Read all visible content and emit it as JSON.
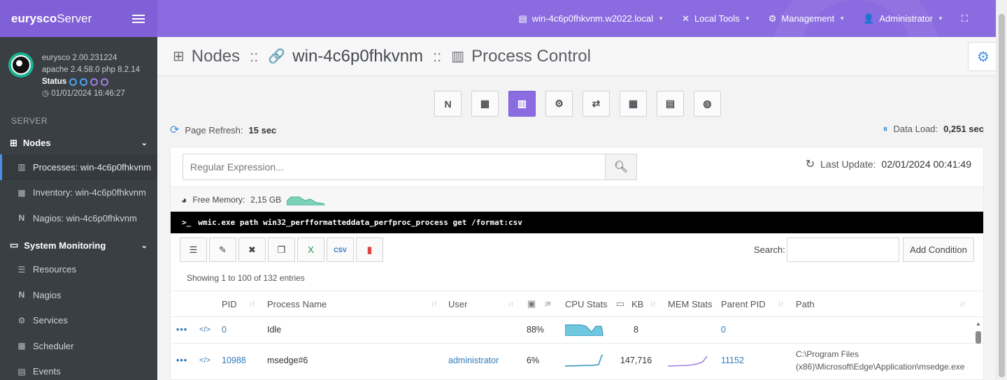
{
  "brand": {
    "bold": "eurysco",
    "rest": "Server"
  },
  "profile": {
    "version": "eurysco 2.00.231224",
    "stack": "apache 2.4.58.0  php 8.2.14",
    "status_label": "Status",
    "datetime": "01/01/2024 16:46:27"
  },
  "sidebar": {
    "section_label": "SERVER",
    "nodes_label": "Nodes",
    "nodes_items": [
      {
        "label": "Processes: win-4c6p0fhkvnm"
      },
      {
        "label": "Inventory: win-4c6p0fhkvnm"
      },
      {
        "label": "Nagios: win-4c6p0fhkvnm"
      }
    ],
    "monitoring_label": "System Monitoring",
    "monitoring_items": [
      {
        "label": "Resources"
      },
      {
        "label": "Nagios"
      },
      {
        "label": "Services"
      },
      {
        "label": "Scheduler"
      },
      {
        "label": "Events"
      }
    ]
  },
  "topnav": {
    "host": "win-4c6p0fhkvnm.w2022.local",
    "tools": "Local Tools",
    "management": "Management",
    "user": "Administrator"
  },
  "page": {
    "section": "Nodes",
    "sep": "::",
    "host": "win-4c6p0fhkvnm",
    "title": "Process Control"
  },
  "refresh": {
    "label": "Page Refresh:",
    "value": "15 sec"
  },
  "dataload": {
    "label": "Data Load:",
    "value": "0,251 sec"
  },
  "search": {
    "placeholder": "Regular Expression..."
  },
  "last_update": {
    "label": "Last Update:",
    "value": "02/01/2024 00:41:49"
  },
  "memory": {
    "label": "Free Memory:",
    "value": "2,15 GB"
  },
  "command": "wmic.exe path win32_perfformatteddata_perfproc_process get /format:csv",
  "table_search_label": "Search:",
  "add_condition": "Add Condition",
  "showing": "Showing 1 to 100 of 132 entries",
  "columns": {
    "pid": "PID",
    "name": "Process Name",
    "user": "User",
    "cpu_stats": "CPU Stats",
    "kb": "KB",
    "mem_stats": "MEM Stats",
    "parent_pid": "Parent PID",
    "path": "Path"
  },
  "rows": [
    {
      "pid": "0",
      "name": "Idle",
      "user": "",
      "cpu": "88%",
      "kb": "8",
      "parent": "0",
      "path": ""
    },
    {
      "pid": "10988",
      "name": "msedge#6",
      "user": "administrator",
      "cpu": "6%",
      "kb": "147,716",
      "parent": "11152",
      "path": "C:\\Program Files (x86)\\Microsoft\\Edge\\Application\\msedge.exe"
    }
  ],
  "colors": {
    "accent": "#8a6be0",
    "sidebar": "#3a3f44",
    "link": "#337ab7",
    "spark": "#5bc0de"
  }
}
